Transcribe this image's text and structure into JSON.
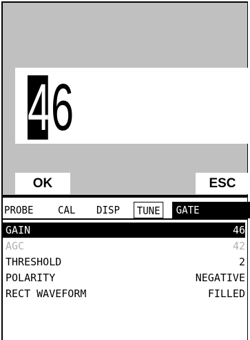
{
  "editor": {
    "value": "46",
    "highlighted_digit": "4",
    "rest_digits": "6",
    "ok_label": "OK",
    "esc_label": "ESC"
  },
  "tabs": [
    {
      "label": "PROBE",
      "state": "normal"
    },
    {
      "label": "CAL",
      "state": "normal"
    },
    {
      "label": "DISP",
      "state": "normal"
    },
    {
      "label": "TUNE",
      "state": "active"
    },
    {
      "label": "GATE",
      "state": "inverse"
    }
  ],
  "menu": [
    {
      "label": "GAIN",
      "value": "46",
      "state": "selected"
    },
    {
      "label": "AGC",
      "value": "42",
      "state": "disabled"
    },
    {
      "label": "THRESHOLD",
      "value": "2",
      "state": "normal"
    },
    {
      "label": "POLARITY",
      "value": "NEGATIVE",
      "state": "normal"
    },
    {
      "label": "RECT WAVEFORM",
      "value": "FILLED",
      "state": "normal"
    }
  ],
  "colors": {
    "dialog_background": "#c0c0c0",
    "selection": "#000000",
    "disabled_text": "#b0b0b0"
  }
}
